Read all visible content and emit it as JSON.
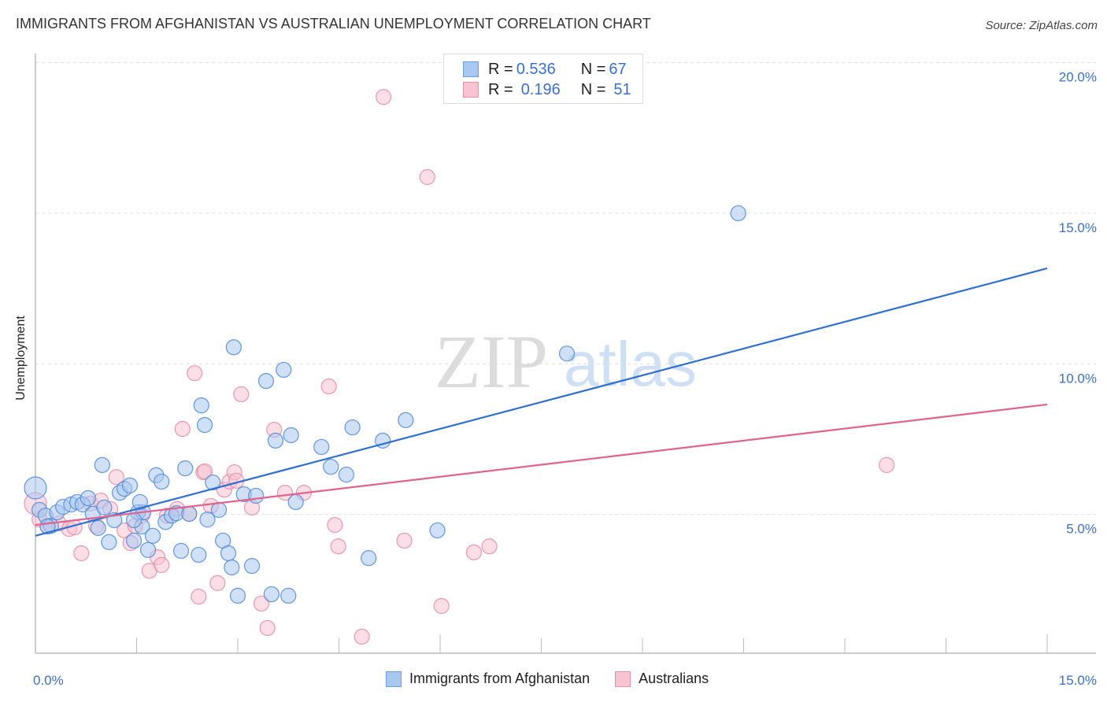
{
  "header": {
    "title": "IMMIGRANTS FROM AFGHANISTAN VS AUSTRALIAN UNEMPLOYMENT CORRELATION CHART",
    "source": "Source: ZipAtlas.com"
  },
  "watermark": {
    "zip": "ZIP",
    "atlas": "atlas"
  },
  "legend": {
    "rows": [
      {
        "r_label": "R = ",
        "r_value": "0.536",
        "n_label": "N = ",
        "n_value": "67",
        "color": "#a9c8f0",
        "border": "#6c9de0"
      },
      {
        "r_label": "R = ",
        "r_value": "0.196",
        "n_label": "N = ",
        "n_value": "51",
        "color": "#f8c3d2",
        "border": "#e890aa"
      }
    ]
  },
  "colors": {
    "blue_fill": "#a9c8f0",
    "blue_stroke": "#4a86d8",
    "blue_line": "#2f6fd0",
    "pink_fill": "#f8c3d2",
    "pink_stroke": "#e38aa6",
    "pink_line": "#e0648e",
    "tick_label": "#3a70c9",
    "grid": "#dddddd",
    "axis": "#bbbbbb"
  },
  "chart_data": {
    "type": "scatter",
    "title": "IMMIGRANTS FROM AFGHANISTAN VS AUSTRALIAN UNEMPLOYMENT CORRELATION CHART",
    "xlabel": "",
    "ylabel": "Unemployment",
    "xlim": [
      0,
      15
    ],
    "ylim": [
      0,
      20.4
    ],
    "x_tick_labels": [
      "0.0%",
      "15.0%"
    ],
    "y_ticks": [
      5,
      10,
      15,
      20
    ],
    "y_tick_labels": [
      "5.0%",
      "10.0%",
      "15.0%",
      "20.0%"
    ],
    "x_minor_ticks": [
      0,
      1.5,
      3,
      4.5,
      6,
      7.5,
      9,
      10.5,
      12,
      13.5,
      15
    ],
    "grid": true,
    "legend_position": "top-center",
    "series": [
      {
        "name": "Immigrants from Afghanistan",
        "R": 0.536,
        "N": 67,
        "trend": {
          "x": [
            0,
            15
          ],
          "y": [
            4.29,
            13.17
          ]
        },
        "points": [
          [
            0.0,
            5.88
          ],
          [
            0.06,
            5.15
          ],
          [
            0.15,
            4.96
          ],
          [
            0.23,
            4.62
          ],
          [
            0.32,
            5.07
          ],
          [
            0.41,
            5.25
          ],
          [
            0.53,
            5.33
          ],
          [
            0.62,
            5.41
          ],
          [
            0.7,
            5.33
          ],
          [
            0.78,
            5.54
          ],
          [
            0.85,
            5.02
          ],
          [
            0.93,
            4.55
          ],
          [
            0.99,
            6.64
          ],
          [
            1.02,
            5.23
          ],
          [
            1.09,
            4.08
          ],
          [
            1.17,
            4.81
          ],
          [
            1.25,
            5.72
          ],
          [
            1.32,
            5.85
          ],
          [
            1.4,
            5.96
          ],
          [
            1.46,
            4.13
          ],
          [
            1.52,
            5.07
          ],
          [
            1.58,
            4.6
          ],
          [
            1.6,
            5.07
          ],
          [
            1.67,
            3.82
          ],
          [
            1.74,
            4.29
          ],
          [
            1.79,
            6.3
          ],
          [
            1.87,
            6.09
          ],
          [
            1.93,
            4.75
          ],
          [
            2.02,
            4.96
          ],
          [
            2.09,
            5.04
          ],
          [
            2.16,
            3.79
          ],
          [
            2.22,
            6.53
          ],
          [
            2.28,
            5.02
          ],
          [
            2.42,
            3.66
          ],
          [
            2.46,
            8.62
          ],
          [
            2.51,
            7.97
          ],
          [
            2.55,
            4.83
          ],
          [
            2.63,
            6.06
          ],
          [
            2.72,
            5.15
          ],
          [
            2.78,
            4.13
          ],
          [
            2.86,
            3.71
          ],
          [
            2.91,
            3.24
          ],
          [
            2.94,
            10.55
          ],
          [
            3.0,
            2.3
          ],
          [
            3.09,
            5.67
          ],
          [
            3.21,
            3.29
          ],
          [
            3.27,
            5.62
          ],
          [
            3.42,
            9.43
          ],
          [
            3.5,
            2.35
          ],
          [
            3.56,
            7.45
          ],
          [
            3.68,
            9.8
          ],
          [
            3.75,
            2.3
          ],
          [
            3.79,
            7.63
          ],
          [
            3.86,
            5.41
          ],
          [
            4.24,
            7.24
          ],
          [
            4.38,
            6.58
          ],
          [
            4.61,
            6.32
          ],
          [
            4.7,
            7.89
          ],
          [
            4.94,
            3.55
          ],
          [
            5.15,
            7.45
          ],
          [
            5.49,
            8.13
          ],
          [
            5.96,
            4.47
          ],
          [
            7.88,
            10.34
          ],
          [
            10.42,
            15.0
          ],
          [
            1.55,
            5.41
          ],
          [
            1.46,
            4.81
          ],
          [
            0.18,
            4.6
          ]
        ]
      },
      {
        "name": "Australians",
        "R": 0.196,
        "N": 51,
        "trend": {
          "x": [
            0,
            15
          ],
          "y": [
            4.65,
            8.65
          ]
        },
        "points": [
          [
            0.0,
            5.36
          ],
          [
            0.06,
            4.83
          ],
          [
            0.18,
            4.62
          ],
          [
            0.35,
            4.7
          ],
          [
            0.5,
            4.52
          ],
          [
            0.58,
            4.57
          ],
          [
            0.68,
            3.71
          ],
          [
            0.82,
            5.36
          ],
          [
            0.9,
            4.62
          ],
          [
            0.97,
            5.46
          ],
          [
            1.11,
            5.18
          ],
          [
            1.2,
            6.24
          ],
          [
            1.32,
            4.47
          ],
          [
            1.41,
            4.05
          ],
          [
            1.48,
            4.62
          ],
          [
            1.58,
            4.96
          ],
          [
            1.69,
            3.13
          ],
          [
            1.81,
            3.58
          ],
          [
            1.87,
            3.32
          ],
          [
            1.95,
            4.96
          ],
          [
            2.1,
            5.18
          ],
          [
            2.18,
            7.84
          ],
          [
            2.28,
            5.02
          ],
          [
            2.36,
            9.69
          ],
          [
            2.42,
            2.27
          ],
          [
            2.49,
            6.4
          ],
          [
            2.6,
            5.28
          ],
          [
            2.7,
            2.72
          ],
          [
            2.8,
            5.82
          ],
          [
            2.88,
            6.09
          ],
          [
            2.95,
            6.4
          ],
          [
            3.05,
            8.99
          ],
          [
            3.21,
            5.23
          ],
          [
            3.35,
            2.04
          ],
          [
            3.44,
            1.23
          ],
          [
            3.54,
            7.81
          ],
          [
            3.7,
            5.72
          ],
          [
            3.98,
            5.72
          ],
          [
            4.35,
            9.25
          ],
          [
            4.44,
            4.65
          ],
          [
            4.49,
            3.94
          ],
          [
            4.84,
            0.94
          ],
          [
            5.16,
            18.86
          ],
          [
            5.47,
            4.13
          ],
          [
            5.81,
            16.2
          ],
          [
            6.02,
            1.96
          ],
          [
            6.5,
            3.74
          ],
          [
            6.73,
            3.94
          ],
          [
            12.62,
            6.64
          ],
          [
            2.98,
            6.12
          ],
          [
            2.51,
            6.43
          ]
        ]
      }
    ]
  },
  "bottom_legend": {
    "items": [
      {
        "label": "Immigrants from Afghanistan",
        "color": "#a9c8f0",
        "border": "#6c9de0"
      },
      {
        "label": "Australians",
        "color": "#f8c3d2",
        "border": "#e890aa"
      }
    ]
  }
}
